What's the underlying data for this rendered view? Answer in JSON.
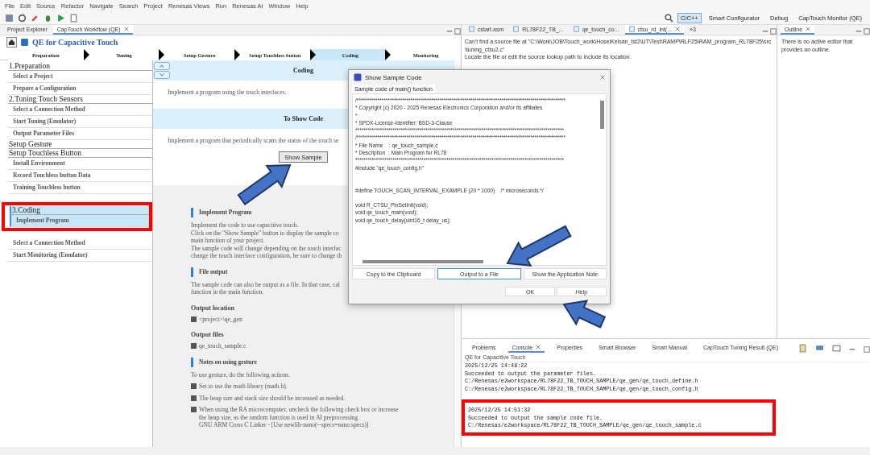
{
  "menu": [
    "File",
    "Edit",
    "Source",
    "Refactor",
    "Navigate",
    "Search",
    "Project",
    "Renesas Views",
    "Run",
    "Renesas AI",
    "Window",
    "Help"
  ],
  "perspectives": [
    {
      "label": "C/C++",
      "selected": true
    },
    {
      "label": "Smart Configurator",
      "selected": false
    },
    {
      "label": "Debug",
      "selected": false
    },
    {
      "label": "CapTouch Monitor (QE)",
      "selected": false
    }
  ],
  "left_tabs": [
    {
      "label": "Project Explorer",
      "selected": false
    },
    {
      "label": "CapTouch Workflow (QE)",
      "selected": true
    }
  ],
  "workflow": {
    "title": "QE for Capacitive Touch",
    "steps": [
      {
        "label": "Preparation",
        "selected": false
      },
      {
        "label": "Tuning",
        "selected": false
      },
      {
        "label": "Setup Gesture",
        "selected": false
      },
      {
        "label": "Setup Touchless button",
        "selected": false
      },
      {
        "label": "Coding",
        "selected": true
      },
      {
        "label": "Monitoring",
        "selected": false
      }
    ],
    "sidebar": [
      {
        "label": "1.Preparation",
        "selected": false,
        "highlighted": false,
        "children": [
          {
            "label": "Select a Project",
            "selected": false
          },
          {
            "label": "Prepare a Configuration",
            "selected": false
          }
        ]
      },
      {
        "label": "2.Tuning Touch Sensors",
        "selected": false,
        "highlighted": false,
        "children": [
          {
            "label": "Select a Connection Method",
            "selected": false
          },
          {
            "label": "Start Tuning (Emulator)",
            "selected": false
          },
          {
            "label": "Output Parameter Files",
            "selected": false
          }
        ]
      },
      {
        "label": "Setup Gesture",
        "selected": false,
        "highlighted": false
      },
      {
        "label": "Setup Touchless Button",
        "selected": false,
        "highlighted": false,
        "children": [
          {
            "label": "Install Environment",
            "selected": false
          },
          {
            "label": "Record Touchless button Data",
            "selected": false
          },
          {
            "label": "Training Touchless button",
            "selected": false
          }
        ]
      },
      {
        "label": "3.Coding",
        "selected": true,
        "highlighted": true,
        "children": [
          {
            "label": "Implement Program",
            "selected": true
          }
        ]
      },
      {
        "highlighted": false,
        "children": [
          {
            "label": "Select a Connection Method",
            "selected": false
          },
          {
            "label": "Start Monitoring (Emulator)",
            "selected": false
          }
        ]
      }
    ],
    "page": {
      "title": "Coding",
      "intro": "Implement a program using the touch interfaces.",
      "section_title": "To Show Code",
      "section_text": "Implement a program that periodically scans the status of the touch se",
      "button": "Show Sample",
      "blocks": [
        {
          "kind": "heading",
          "text": "Implement Program"
        },
        {
          "kind": "paragraph",
          "lines": [
            "Implement the code to use capacitive touch.",
            "Click on the \"Show Sample\" button to display the sample co",
            "main function of your project.",
            "The sample code will change depending on the touch interfac",
            "change the touch interface configuration, be sure to change th"
          ]
        },
        {
          "kind": "heading",
          "text": "File output"
        },
        {
          "kind": "paragraph",
          "lines": [
            "The sample code can also be output as a file. In that case, cal",
            "function in the main function."
          ]
        },
        {
          "kind": "subheading",
          "text": "Output location"
        },
        {
          "kind": "bullet",
          "lines": [
            "<project>\\qe_gen"
          ]
        },
        {
          "kind": "subheading",
          "text": "Output files"
        },
        {
          "kind": "bullet",
          "lines": [
            "qe_touch_sample.c"
          ]
        },
        {
          "kind": "heading",
          "text": "Notes on using gesture"
        },
        {
          "kind": "paragraph",
          "lines": [
            "To use gesture, do the following actions."
          ]
        },
        {
          "kind": "bullet",
          "lines": [
            "Set to use the math library (math.h)."
          ]
        },
        {
          "kind": "bullet",
          "lines": [
            "The heap size and stack size should be increased as needed."
          ]
        },
        {
          "kind": "bullet",
          "lines": [
            "When using the RA microcomputer, uncheck the following check box or increase",
            "the heap size, as the random function is used in AI preprocessing.",
            "GNU ARM Cross C Linker - [Use newlib-nano(--specs=nano.specs)]"
          ]
        }
      ]
    }
  },
  "editor": {
    "tabs": [
      {
        "label": "cstart.asm",
        "selected": false
      },
      {
        "label": "RL78F22_TB_...",
        "selected": false
      },
      {
        "label": "qe_touch_co...",
        "selected": false
      },
      {
        "label": "ctsu_rd_int(...",
        "selected": true
      }
    ],
    "overflow": "»3",
    "message": [
      "Can't find a source file at \"C:\\Work\\JOB\\Touch_work\\HoseiKeisan_tst2\\UT\\Test\\RAMP\\RLF25\\RAM_program_RL78F25\\src",
      "\\tuning_ctsu2.c\"",
      "Locate the file or edit the source lookup path to include its location."
    ]
  },
  "outline": {
    "tab": "Outline",
    "message": "There is no active editor that provides an outline."
  },
  "console": {
    "tabs": [
      {
        "label": "Problems",
        "selected": false
      },
      {
        "label": "Console",
        "selected": true
      },
      {
        "label": "Properties",
        "selected": false
      },
      {
        "label": "Smart Browser",
        "selected": false
      },
      {
        "label": "Smart Manual",
        "selected": false
      },
      {
        "label": "CapTouch Tuning Result (QE)",
        "selected": false
      }
    ],
    "title": "QE for Capacitive Touch",
    "entries": [
      {
        "highlighted": false,
        "lines": [
          "2025/12/25 14:48:22",
          "Succeeded to output the parameter files.",
          "C:/Renesas/e2workspace/RL78F22_TB_TOUCH_SAMPLE/qe_gen/qe_touch_define.h",
          "C:/Renesas/e2workspace/RL78F22_TB_TOUCH_SAMPLE/qe_gen/qe_touch_config.h"
        ]
      },
      {
        "highlighted": true,
        "lines": [
          "2025/12/25 14:51:32",
          "Succeeded to output the sample code file.",
          "C:/Renesas/e2workspace/RL78F22_TB_TOUCH_SAMPLE/qe_gen/qe_touch_sample.c"
        ]
      }
    ]
  },
  "dialog": {
    "title": "Show Sample Code",
    "tab": "Sample code of main() function",
    "code": "/*****************************************************************************************************\n* Copyright (c) 2020 - 2025 Renesas Electronics Corporation and/or its affiliates\n*\n* SPDX-License-Identifier: BSD-3-Clause\n*****************************************************************************************************\n/*****************************************************************************************************\n* File Name    : qe_touch_sample.c\n* Description  : Main Program for RL78\n*****************************************************************************************************\n#include \"qe_touch_config.h\"\n\n\n#define TOUCH_SCAN_INTERVAL_EXAMPLE (20 * 1000)    /* microseconds */\n\nvoid R_CTSU_PinSetInit(void);\nvoid qe_touch_main(void);\nvoid qe_touch_delay(uint16_t delay_us);",
    "buttons": [
      {
        "label": "Copy to the Clipboard",
        "focused": false
      },
      {
        "label": "Output to a File",
        "focused": true
      },
      {
        "label": "Show the Application Note",
        "focused": false
      }
    ],
    "footer": [
      {
        "label": "OK",
        "focused": false
      },
      {
        "label": "Help",
        "focused": false
      }
    ]
  }
}
